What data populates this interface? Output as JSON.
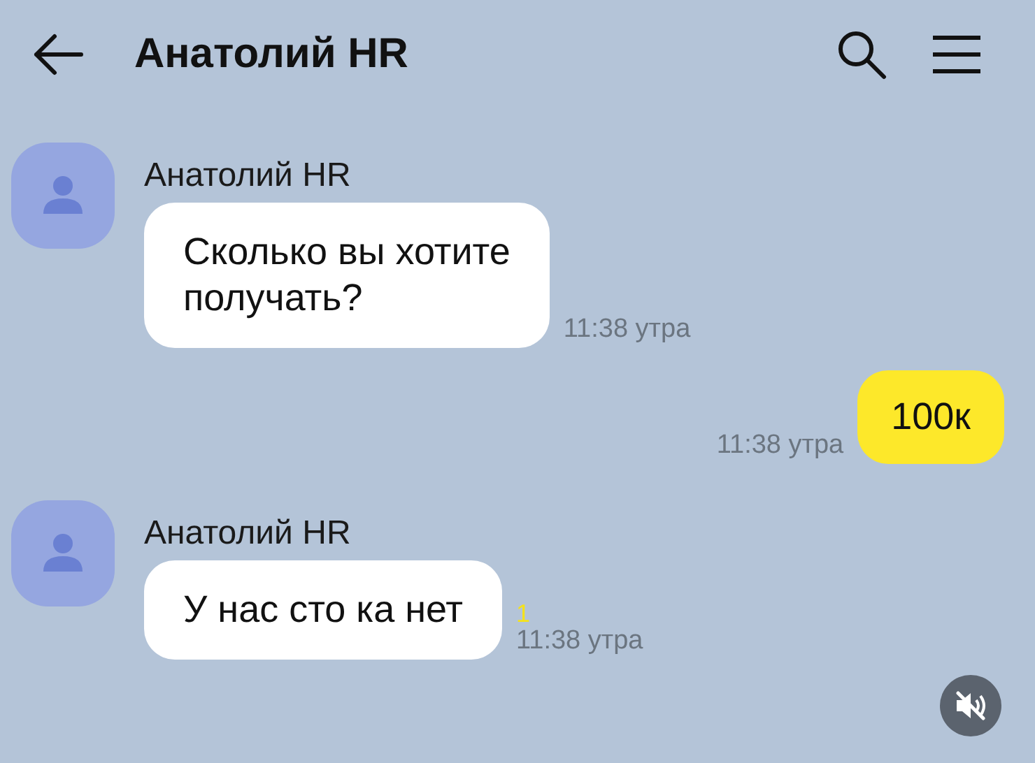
{
  "header": {
    "title": "Анатолий HR"
  },
  "messages": [
    {
      "kind": "incoming",
      "sender": "Анатолий HR",
      "text": "Сколько вы хотите\nполучать?",
      "time": "11:38 утра"
    },
    {
      "kind": "outgoing",
      "text": "100к",
      "time": "11:38 утра"
    },
    {
      "kind": "incoming",
      "sender": "Анатолий HR",
      "text": "У нас сто ка нет",
      "time": "11:38 утра",
      "unread": "1"
    }
  ],
  "mute_button": {
    "muted": true
  }
}
